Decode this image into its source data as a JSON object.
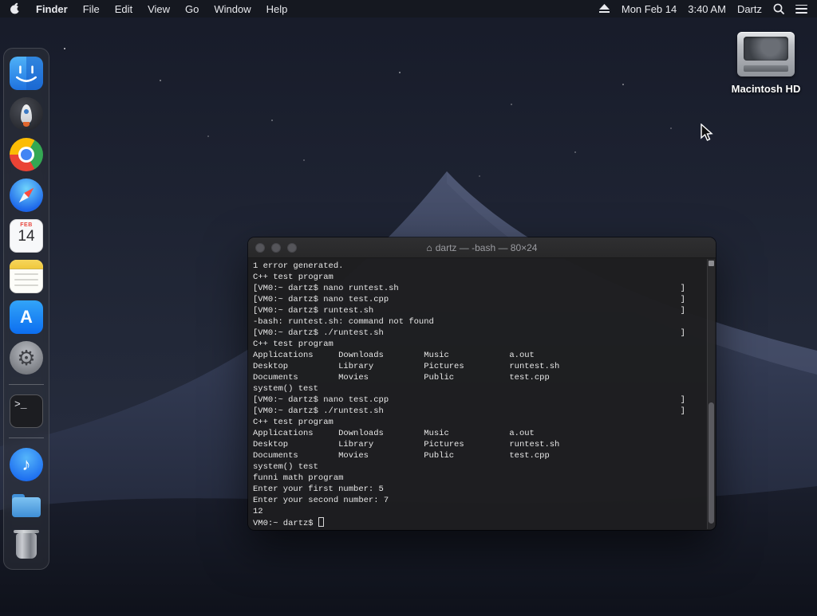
{
  "menu_bar": {
    "app_name": "Finder",
    "items": [
      "File",
      "Edit",
      "View",
      "Go",
      "Window",
      "Help"
    ],
    "date": "Mon Feb 14",
    "time": "3:40 AM",
    "user": "Dartz"
  },
  "desktop": {
    "drive_label": "Macintosh HD"
  },
  "dock": {
    "calendar": {
      "month": "FEB",
      "day": "14"
    },
    "glyphs": {
      "app_store": "A",
      "music": "♪",
      "gear": "⚙",
      "terminal_prompt": ">_"
    }
  },
  "terminal_window": {
    "title": "dartz — -bash — 80×24",
    "title_icon": "⌂",
    "prompt": "VM0:~ dartz$ ",
    "lines": [
      "1 error generated.",
      "C++ test program",
      "[VM0:~ dartz$ nano runtest.sh                                                        ]",
      "[VM0:~ dartz$ nano test.cpp                                                          ]",
      "[VM0:~ dartz$ runtest.sh                                                             ]",
      "-bash: runtest.sh: command not found",
      "[VM0:~ dartz$ ./runtest.sh                                                           ]",
      "C++ test program",
      "Applications     Downloads        Music            a.out",
      "Desktop          Library          Pictures         runtest.sh",
      "Documents        Movies           Public           test.cpp",
      "system() test",
      "[VM0:~ dartz$ nano test.cpp                                                          ]",
      "[VM0:~ dartz$ ./runtest.sh                                                           ]",
      "C++ test program",
      "Applications     Downloads        Music            a.out",
      "Desktop          Library          Pictures         runtest.sh",
      "Documents        Movies           Public           test.cpp",
      "system() test",
      "funni math program",
      "Enter your first number: 5",
      "Enter your second number: 7",
      "12"
    ]
  }
}
